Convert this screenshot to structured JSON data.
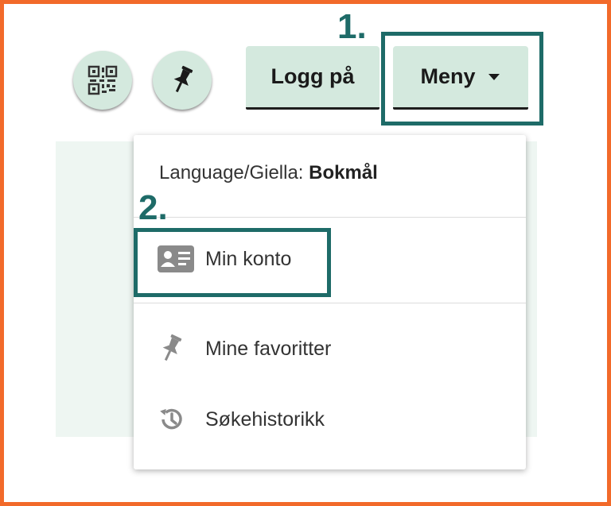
{
  "header": {
    "qr_button_icon": "qr-code-icon",
    "pin_button_icon": "pin-icon",
    "login_label": "Logg på",
    "menu_label": "Meny",
    "menu_caret_icon": "caret-down-icon"
  },
  "annotations": {
    "step1": "1.",
    "step2": "2."
  },
  "dropdown": {
    "language_prefix": "Language/Giella:",
    "language_value": "Bokmål",
    "items": [
      {
        "label": "Min konto",
        "icon": "id-card-icon"
      },
      {
        "label": "Mine favoritter",
        "icon": "pin-icon"
      },
      {
        "label": "Søkehistorikk",
        "icon": "history-icon"
      }
    ]
  },
  "colors": {
    "frame": "#f26a2a",
    "button_bg": "#d4e9de",
    "annotation": "#1e6b68"
  }
}
